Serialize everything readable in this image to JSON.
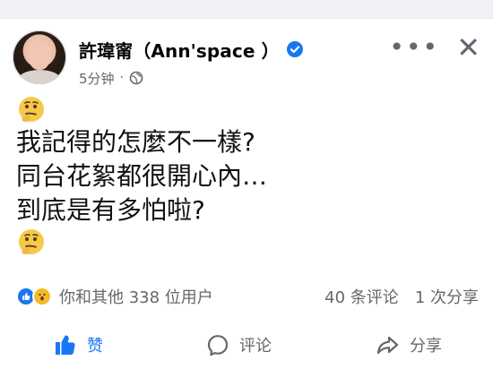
{
  "post": {
    "author": "許瑋甯（Ann'space ）",
    "time": "5分钟",
    "visibility_icon": "globe-icon",
    "verified_icon": "verified-badge-icon"
  },
  "content": {
    "lines": [
      "我記得的怎麼不一樣?",
      "同台花絮都很開心內…",
      "到底是有多怕啦?"
    ]
  },
  "stats": {
    "reactions_text": "你和其他 338 位用户",
    "comments_text": "40 条评论",
    "shares_text": "1 次分享"
  },
  "actions": {
    "like": "赞",
    "comment": "评论",
    "share": "分享"
  },
  "colors": {
    "brand_blue": "#1877f2",
    "muted_text": "#65676b",
    "wow_yellow": "#f7b928"
  }
}
